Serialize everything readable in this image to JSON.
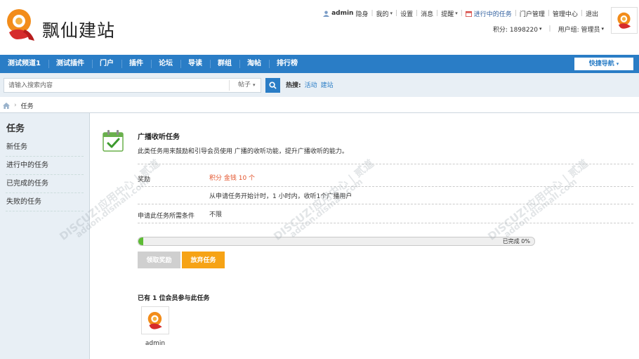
{
  "header": {
    "site_name": "飘仙建站",
    "topbar": {
      "username": "admin",
      "invisible": "隐身",
      "mine": "我的",
      "settings": "设置",
      "messages": "消息",
      "reminders": "提醒",
      "tasks_in_progress": "进行中的任务",
      "portal_manage": "门户管理",
      "admin_center": "管理中心",
      "logout": "退出"
    },
    "subbar": {
      "points": "积分: 1898220",
      "user_group": "用户组: 管理员"
    }
  },
  "nav": {
    "items": [
      "测试频道1",
      "测试插件",
      "门户",
      "插件",
      "论坛",
      "导读",
      "群组",
      "淘帖",
      "排行榜"
    ],
    "quick_nav": "快捷导航"
  },
  "search": {
    "placeholder": "请输入搜索内容",
    "type": "帖子",
    "hot_label": "热搜:",
    "hot_items": [
      "活动",
      "建站"
    ]
  },
  "breadcrumb": {
    "current": "任务"
  },
  "sidebar": {
    "title": "任务",
    "items": [
      "新任务",
      "进行中的任务",
      "已完成的任务",
      "失败的任务"
    ]
  },
  "task": {
    "title": "广播收听任务",
    "description": "此类任务用来鼓励和引导会员使用 广播的收听功能，提升广播收听的能力。",
    "reward_label": "奖励",
    "reward_value": "积分 金钱 10 个",
    "reward_detail": "从申请任务开始计时，1 小时内，收听1个广播用户",
    "condition_label": "申请此任务所需条件",
    "condition_value": "不限",
    "progress_percent": 0,
    "progress_text": "已完成 0%",
    "claim_button": "领取奖励",
    "abandon_button": "放弃任务",
    "participants_text": "已有 1 位会员参与此任务",
    "member_name": "admin"
  },
  "watermark": {
    "brand": "DISCUZ!应用中心 | 贰道",
    "site": "addon.dismall.com"
  },
  "colors": {
    "nav_blue": "#2a7dc6",
    "progress_green": "#5dbb34",
    "abandon_orange": "#f6a315",
    "reward_red": "#e3542c"
  }
}
